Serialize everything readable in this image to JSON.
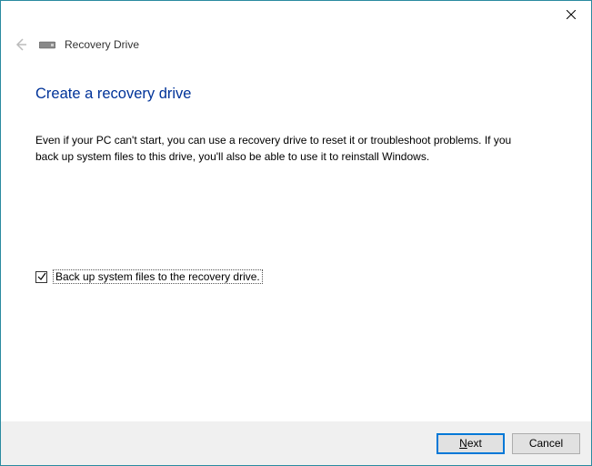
{
  "header": {
    "app_title": "Recovery Drive"
  },
  "main": {
    "page_title": "Create a recovery drive",
    "description": "Even if your PC can't start, you can use a recovery drive to reset it or troubleshoot problems. If you back up system files to this drive, you'll also be able to use it to reinstall Windows.",
    "checkbox_label": "Back up system files to the recovery drive.",
    "checkbox_checked": true
  },
  "footer": {
    "next_label": "Next",
    "cancel_label": "Cancel"
  }
}
